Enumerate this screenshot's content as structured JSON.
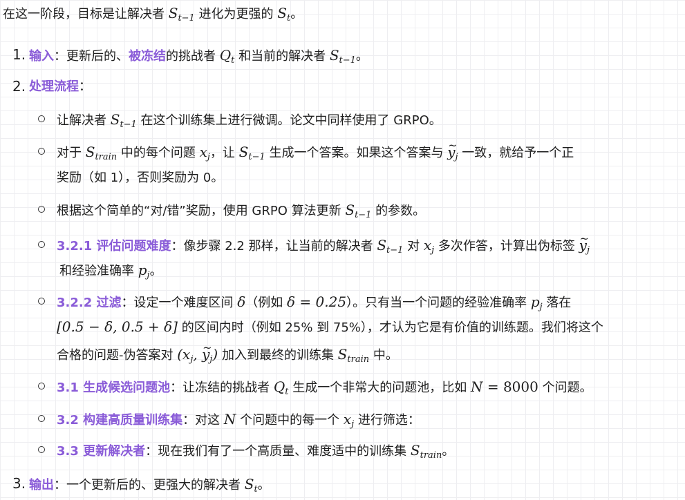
{
  "intro": {
    "prefix": "在这一阶段，目标是让解决者 ",
    "s_prev": "S",
    "s_prev_sub": "t−1",
    "mid": " 进化为更强的 ",
    "s_next": "S",
    "s_next_sub": "t",
    "end": "。"
  },
  "list": [
    {
      "number": "1.",
      "title": "输入",
      "text_a": "：更新后的、",
      "frozen": "被冻结",
      "text_b": "的挑战者 ",
      "q": "Q",
      "q_sub": "t",
      "text_c": " 和当前的解决者 ",
      "s": "S",
      "s_sub": "t−1",
      "end": "。"
    },
    {
      "number": "2.",
      "title": "处理流程",
      "colon": "："
    },
    {
      "number": "3.",
      "title": "输出",
      "text_a": "：一个更新后的、更强大的解决者 ",
      "s": "S",
      "s_sub": "t",
      "end": "。"
    }
  ],
  "sub_items": {
    "a": {
      "pre": "让解决者 ",
      "s": "S",
      "s_sub": "t−1",
      "post": " 在这个训练集上进行微调。论文中同样使用了 GRPO。"
    },
    "b": {
      "pre": "对于 ",
      "s": "S",
      "s_sub": "train",
      "mid1": " 中的每个问题 ",
      "x": "x",
      "x_sub": "j",
      "mid2": "，让 ",
      "s2": "S",
      "s2_sub": "t−1",
      "mid3": " 生成一个答案。如果这个答案与 ",
      "y": "y",
      "y_sub": "j",
      "mid4": " 一致，就给予一个正",
      "line2": "奖励（如 1），否则奖励为 0。"
    },
    "c": {
      "pre": "根据这个简单的“对/错”奖励，使用 GRPO 算法更新 ",
      "s": "S",
      "s_sub": "t−1",
      "post": " 的参数。"
    },
    "d": {
      "title": "3.2.1 评估问题难度",
      "pre": "：像步骤 2.2 那样，让当前的解决者 ",
      "s": "S",
      "s_sub": "t−1",
      "mid": " 对 ",
      "x": "x",
      "x_sub": "j",
      "mid2": " 多次作答，计算出伪标签 ",
      "y": "y",
      "y_sub": "j",
      "line2_pre": "和经验准确率 ",
      "p": "p",
      "p_sub": "j",
      "line2_end": "。"
    },
    "e": {
      "title": "3.2.2 过滤",
      "pre": "：设定一个难度区间 ",
      "delta": "δ",
      "mid1": "（例如 ",
      "delta_eq": "δ = 0.25",
      "mid2": "）。只有当一个问题的经验准确率 ",
      "p": "p",
      "p_sub": "j",
      "mid3": " 落在",
      "interval": "[0.5 − δ, 0.5 + δ]",
      "line2_post": " 的区间内时（例如 25% 到 75%），才认为它是有价值的训练题。我们将这个",
      "line3_pre": "合格的问题-伪答案对 ",
      "pair": "(x",
      "pair_x_sub": "j",
      "pair_mid": ", ",
      "pair_y": "y",
      "pair_y_sub": "j",
      "pair_end": ")",
      "line3_mid": " 加入到最终的训练集 ",
      "s": "S",
      "s_sub": "train",
      "line3_end": " 中。"
    },
    "f": {
      "title": "3.1 生成候选问题池",
      "pre": "：让冻结的挑战者 ",
      "q": "Q",
      "q_sub": "t",
      "mid": " 生成一个非常大的问题池，比如 ",
      "n": "N",
      "eq": " = 8000",
      "post": " 个问题。"
    },
    "g": {
      "title": "3.2 构建高质量训练集",
      "pre": "：对这 ",
      "n": "N",
      "mid": " 个问题中的每一个 ",
      "x": "x",
      "x_sub": "j",
      "post": " 进行筛选："
    },
    "h": {
      "title": "3.3 更新解决者",
      "pre": "：现在我们有了一个高质量、难度适中的训练集 ",
      "s": "S",
      "s_sub": "train",
      "post": "。"
    }
  },
  "colors": {
    "accent": "#8a5cd8",
    "text": "#1f1f1f",
    "grid": "#eeeef1"
  }
}
